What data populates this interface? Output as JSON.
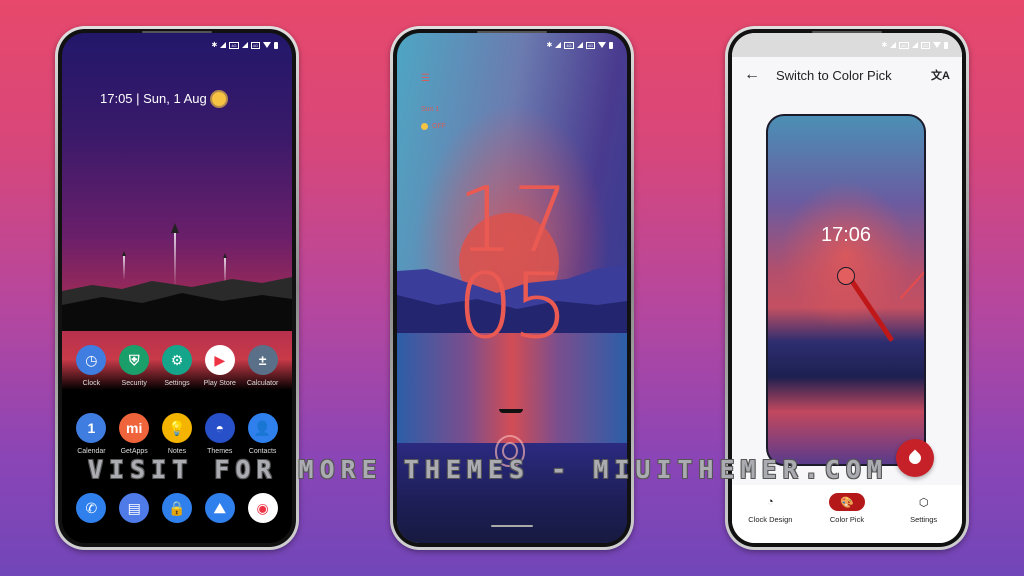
{
  "watermark": "VISIT FOR MORE THEMES - MIUITHEMER.COM",
  "colors": {
    "background_top": "#e7486b",
    "background_bottom": "#7146b8",
    "lock_clock": "#ea5a52",
    "accent_red": "#b51818"
  },
  "status_icons": [
    "bluetooth-icon",
    "signal-icon",
    "volte-icon",
    "signal-icon",
    "volte-icon",
    "wifi-icon",
    "battery-icon"
  ],
  "home_screen": {
    "datetime": "17:05 | Sun, 1 Aug",
    "weather_icon": "sun-icon",
    "apps_row1": [
      {
        "label": "Clock",
        "icon": "clock-icon",
        "color": "#3f7de0",
        "glyph": "◷"
      },
      {
        "label": "Security",
        "icon": "shield-icon",
        "color": "#1a9e6a",
        "glyph": "⛨"
      },
      {
        "label": "Settings",
        "icon": "gear-icon",
        "color": "#14a58a",
        "glyph": "⚙"
      },
      {
        "label": "Play Store",
        "icon": "play-store-icon",
        "color": "#ffffff",
        "glyph": "▶"
      },
      {
        "label": "Calculator",
        "icon": "calculator-icon",
        "color": "#5a7088",
        "glyph": "±"
      }
    ],
    "apps_row2": [
      {
        "label": "Calendar",
        "icon": "calendar-icon",
        "color": "#3f7de0",
        "glyph": "1"
      },
      {
        "label": "GetApps",
        "icon": "getapps-icon",
        "color": "#f0643c",
        "glyph": "mi"
      },
      {
        "label": "Notes",
        "icon": "lightbulb-icon",
        "color": "#f4b400",
        "glyph": "💡"
      },
      {
        "label": "Themes",
        "icon": "themes-icon",
        "color": "#2850c8",
        "glyph": "◓"
      },
      {
        "label": "Contacts",
        "icon": "contacts-icon",
        "color": "#2f80ed",
        "glyph": "👤"
      }
    ],
    "dock": [
      {
        "icon": "phone-icon",
        "color": "#2f80ed",
        "glyph": "✆"
      },
      {
        "icon": "messages-icon",
        "color": "#4f7be8",
        "glyph": "▤"
      },
      {
        "icon": "lock-icon",
        "color": "#2f80ed",
        "glyph": "🔒"
      },
      {
        "icon": "gallery-icon",
        "color": "#2f80ed",
        "glyph": "⛰"
      },
      {
        "icon": "chrome-icon",
        "color": "#ffffff",
        "glyph": "◉"
      }
    ]
  },
  "lock_screen": {
    "clock_hour": "17",
    "clock_minute": "05",
    "menu_icon": "☰",
    "date": "Sun 1",
    "weather": "OFF"
  },
  "clock_app": {
    "title": "Switch to Color Pick",
    "back_icon": "←",
    "translate_icon": "文A",
    "preview_time": "17:06",
    "fab_icon": "water-drop-icon",
    "nav": [
      {
        "label": "Clock Design",
        "icon": "clock-design-icon",
        "glyph": "◔",
        "active": false
      },
      {
        "label": "Color Pick",
        "icon": "palette-icon",
        "glyph": "🎨",
        "active": true
      },
      {
        "label": "Settings",
        "icon": "settings-cube-icon",
        "glyph": "⬡",
        "active": false
      }
    ]
  }
}
